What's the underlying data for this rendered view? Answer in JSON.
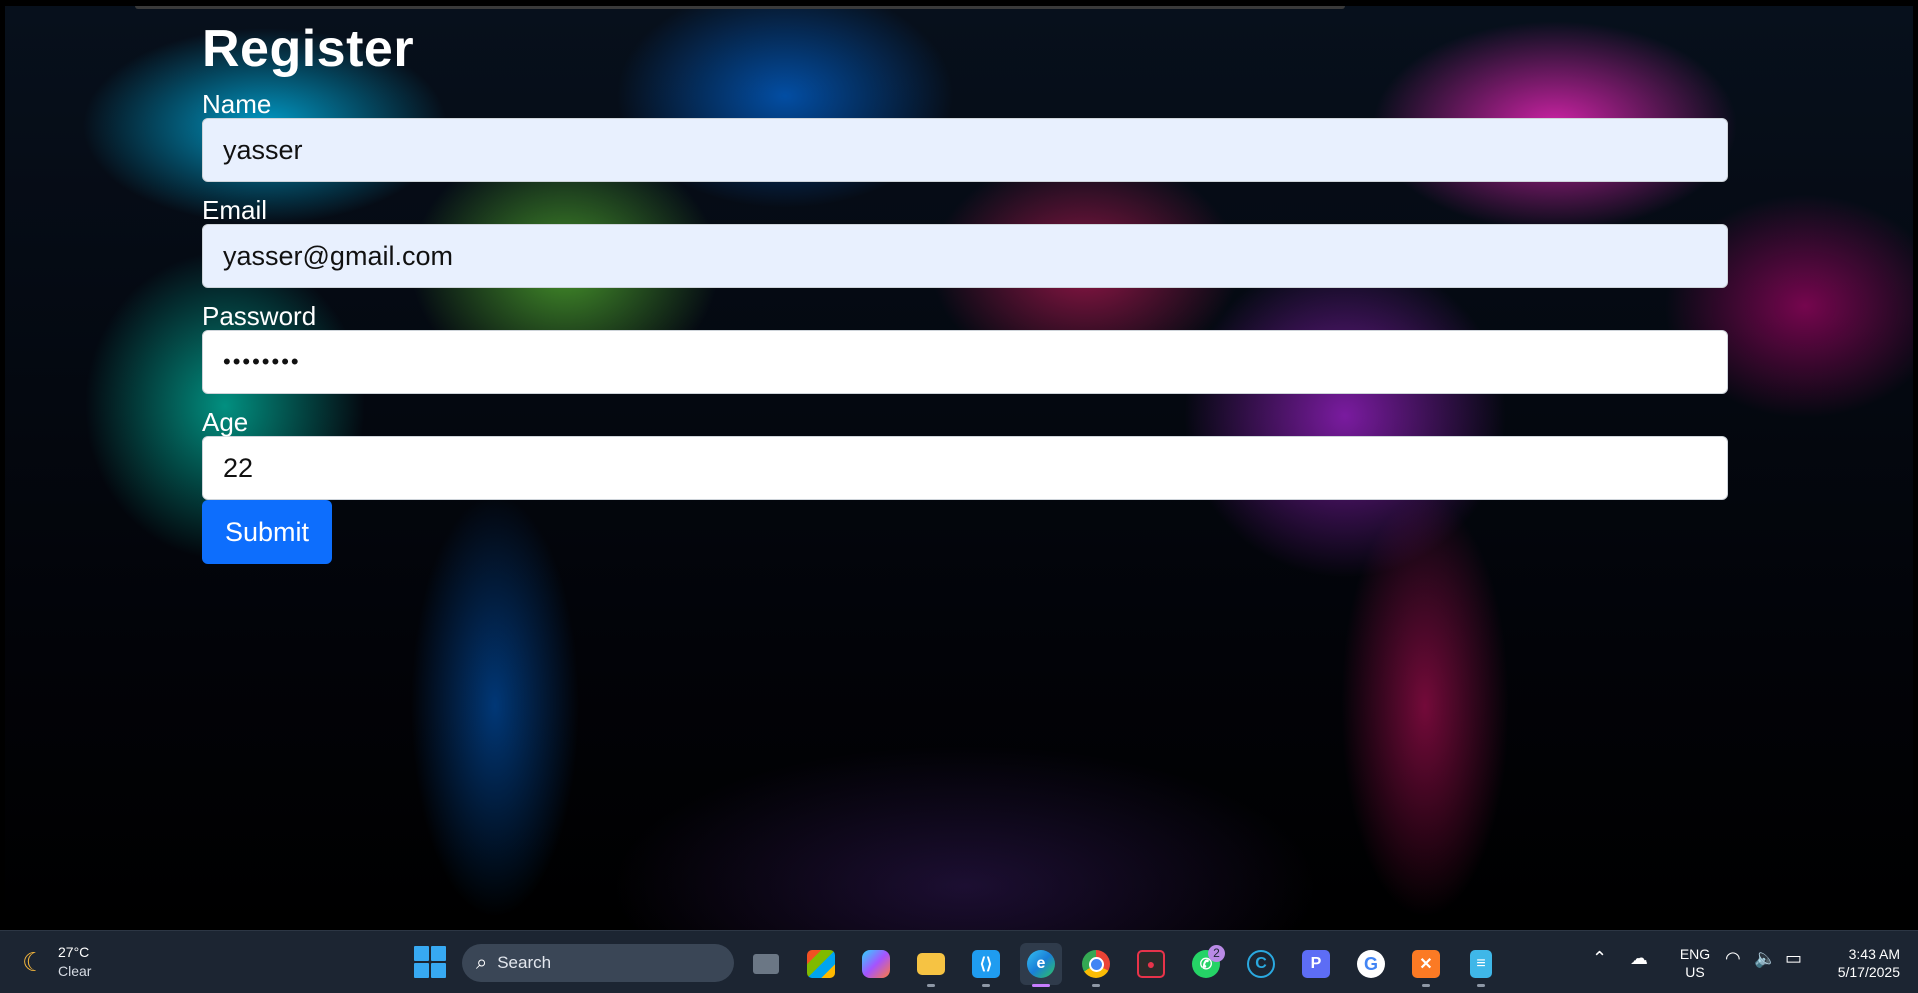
{
  "page": {
    "title": "Register",
    "fields": [
      {
        "label": "Name",
        "value": "yasser"
      },
      {
        "label": "Email",
        "value": "yasser@gmail.com"
      },
      {
        "label": "Password",
        "value": "••••••••"
      },
      {
        "label": "Age",
        "value": "22"
      }
    ],
    "submit_label": "Submit"
  },
  "taskbar": {
    "weather": {
      "temp": "27°C",
      "condition": "Clear",
      "icon": "moon-icon"
    },
    "search_placeholder": "Search",
    "apps": [
      {
        "name": "task-view",
        "icon": "task-view-icon"
      },
      {
        "name": "microsoft-store",
        "icon": "store-icon"
      },
      {
        "name": "copilot",
        "icon": "copilot-icon"
      },
      {
        "name": "file-explorer",
        "icon": "folder-icon"
      },
      {
        "name": "vscode",
        "icon": "vscode-icon"
      },
      {
        "name": "edge",
        "icon": "edge-icon"
      },
      {
        "name": "chrome",
        "icon": "chrome-icon"
      },
      {
        "name": "screen-recorder",
        "icon": "recorder-icon"
      },
      {
        "name": "whatsapp",
        "icon": "whatsapp-icon",
        "badge": "2"
      },
      {
        "name": "c-app",
        "icon": "c-app-icon"
      },
      {
        "name": "p-app",
        "icon": "p-app-icon"
      },
      {
        "name": "google",
        "icon": "google-icon"
      },
      {
        "name": "xampp",
        "icon": "xampp-icon"
      },
      {
        "name": "notepad",
        "icon": "notepad-icon"
      }
    ],
    "lang": {
      "line1": "ENG",
      "line2": "US"
    },
    "clock": {
      "time": "3:43 AM",
      "date": "5/17/2025"
    }
  },
  "colors": {
    "primary_button": "#0d6efd",
    "autofill": "#e8f0fe",
    "taskbar": "#1c2532"
  }
}
